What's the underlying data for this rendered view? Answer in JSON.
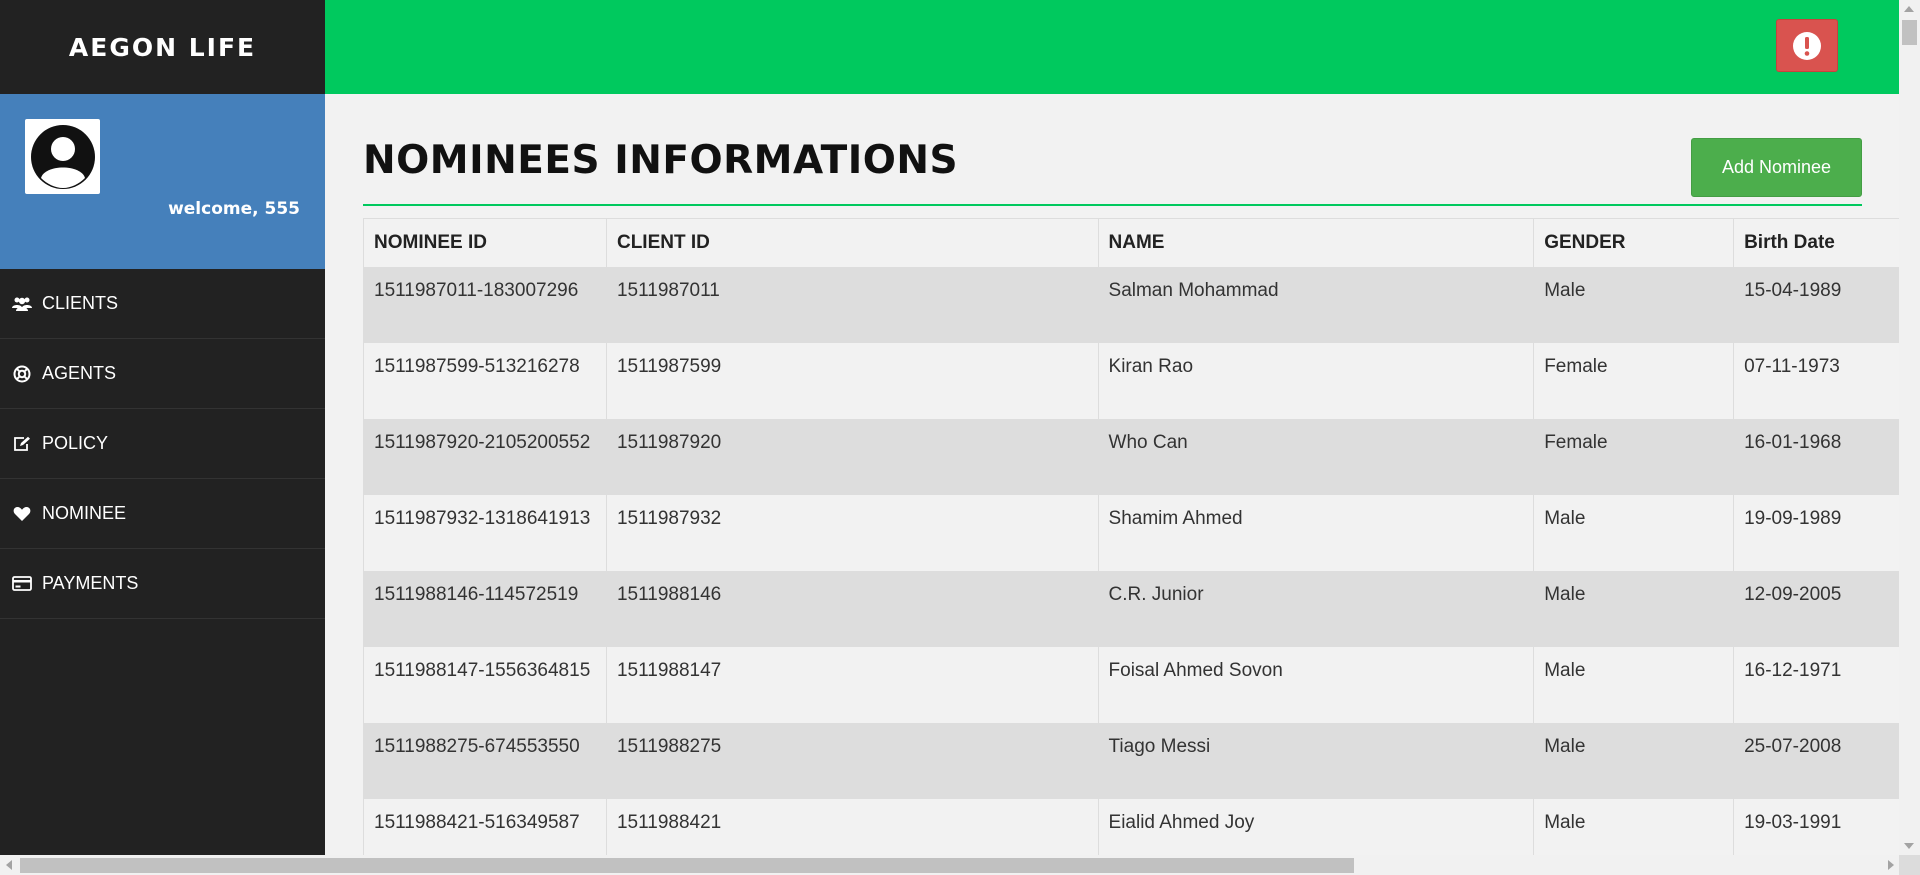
{
  "app": {
    "brand": "AEGON LIFE",
    "welcome": "welcome, 555"
  },
  "sidebar": {
    "items": [
      {
        "label": "CLIENTS",
        "icon": "users-icon"
      },
      {
        "label": "AGENTS",
        "icon": "lifebuoy-icon"
      },
      {
        "label": "POLICY",
        "icon": "edit-icon"
      },
      {
        "label": "NOMINEE",
        "icon": "heart-icon"
      },
      {
        "label": "PAYMENTS",
        "icon": "credit-card-icon"
      }
    ]
  },
  "topbar": {
    "alert_icon": "exclamation-circle-icon",
    "alert_color": "#d9534f"
  },
  "main": {
    "title": "NOMINEES INFORMATIONS",
    "add_button": "Add Nominee"
  },
  "table": {
    "headers": [
      "NOMINEE ID",
      "CLIENT ID",
      "NAME",
      "GENDER",
      "Birth Date"
    ],
    "rows": [
      [
        "1511987011-183007296",
        "1511987011",
        "Salman Mohammad",
        "Male",
        "15-04-1989"
      ],
      [
        "1511987599-513216278",
        "1511987599",
        "Kiran Rao",
        "Female",
        "07-11-1973"
      ],
      [
        "1511987920-2105200552",
        "1511987920",
        "Who Can",
        "Female",
        "16-01-1968"
      ],
      [
        "1511987932-1318641913",
        "1511987932",
        "Shamim Ahmed",
        "Male",
        "19-09-1989"
      ],
      [
        "1511988146-114572519",
        "1511988146",
        "C.R. Junior",
        "Male",
        "12-09-2005"
      ],
      [
        "1511988147-1556364815",
        "1511988147",
        "Foisal Ahmed Sovon",
        "Male",
        "16-12-1971"
      ],
      [
        "1511988275-674553550",
        "1511988275",
        "Tiago Messi",
        "Male",
        "25-07-2008"
      ],
      [
        "1511988421-516349587",
        "1511988421",
        "Eialid Ahmed Joy",
        "Male",
        "19-03-1991"
      ]
    ]
  },
  "colors": {
    "sidebar_bg": "#222222",
    "profile_bg": "#4580bb",
    "topbar_bg": "#00c95e",
    "add_button_bg": "#4cae4c",
    "row_stripe": "#dddddd"
  }
}
